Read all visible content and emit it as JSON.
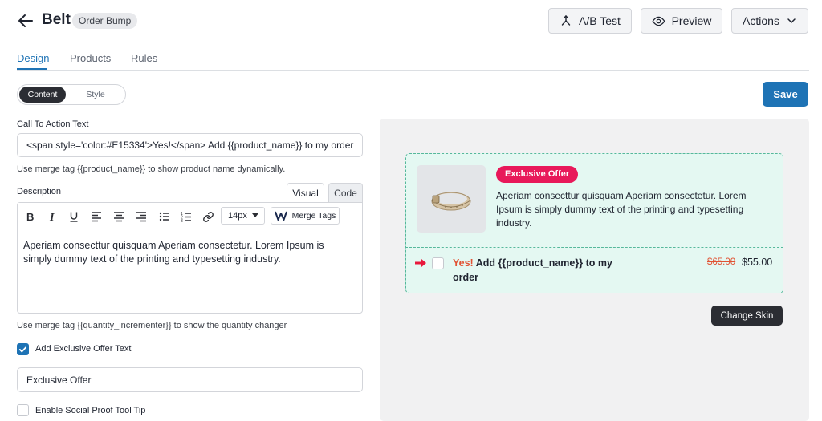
{
  "header": {
    "title": "Belt",
    "badge": "Order Bump",
    "ab_test_label": "A/B Test",
    "preview_label": "Preview",
    "actions_label": "Actions"
  },
  "tabs": [
    {
      "label": "Design",
      "active": true
    },
    {
      "label": "Products",
      "active": false
    },
    {
      "label": "Rules",
      "active": false
    }
  ],
  "mode_toggle": {
    "options": [
      "Content",
      "Style"
    ],
    "selected": "Content"
  },
  "save_label": "Save",
  "cta": {
    "label": "Call To Action Text",
    "value": "<span style='color:#E15334'>Yes!</span> Add {{product_name}} to my order",
    "help": "Use merge tag {{product_name}} to show product name dynamically."
  },
  "description": {
    "label": "Description",
    "tab_visual": "Visual",
    "tab_code": "Code",
    "font_size": "14px",
    "merge_tags_label": "Merge Tags",
    "content": "Aperiam consecttur quisquam Aperiam consectetur. Lorem Ipsum is simply dummy text of the printing and typesetting industry.",
    "help": "Use merge tag {{quantity_incrementer}} to show the quantity changer"
  },
  "exclusive_offer": {
    "checkbox_label": "Add Exclusive Offer Text",
    "checked": true,
    "text_value": "Exclusive Offer"
  },
  "social_proof": {
    "checkbox_label": "Enable Social Proof Tool Tip",
    "checked": false
  },
  "preview": {
    "badge": "Exclusive Offer",
    "description": "Aperiam consecttur quisquam Aperiam consectetur. Lorem Ipsum is simply dummy text of the printing and typesetting industry.",
    "cta_yes": "Yes!",
    "cta_rest": "Add {{product_name}} to my order",
    "old_price": "$65.00",
    "new_price": "$55.00",
    "change_skin_label": "Change Skin"
  },
  "colors": {
    "accent": "#1e73b5",
    "badge": "#e8195a",
    "cta_highlight": "#e15334",
    "preview_bump_bg": "#e4f8f2",
    "preview_bump_border": "#56b89b"
  }
}
